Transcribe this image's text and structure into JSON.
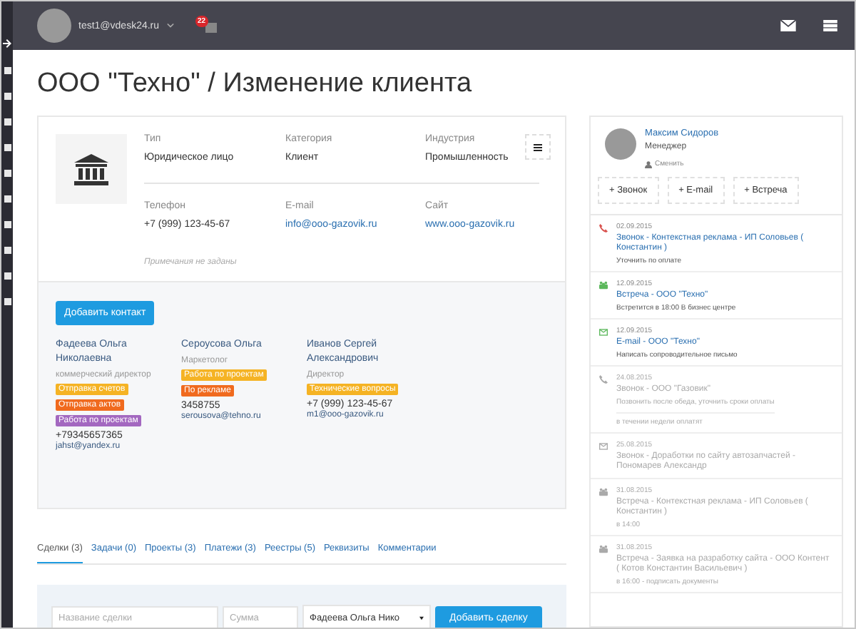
{
  "topbar": {
    "user_email": "test1@vdesk24.ru",
    "notification_count": "22"
  },
  "page_title": "ООО \"Техно\" / Изменение клиента",
  "client": {
    "fields": [
      {
        "label": "Тип",
        "value": "Юридическое лицо",
        "kind": "text"
      },
      {
        "label": "Категория",
        "value": "Клиент",
        "kind": "text"
      },
      {
        "label": "Индустрия",
        "value": "Промышленность",
        "kind": "text"
      },
      {
        "label": "Телефон",
        "value": "+7 (999) 123-45-67",
        "kind": "text"
      },
      {
        "label": "E-mail",
        "value": "info@ooo-gazovik.ru",
        "kind": "link"
      },
      {
        "label": "Сайт",
        "value": "www.ooo-gazovik.ru",
        "kind": "link"
      }
    ],
    "notes": "Примечания не заданы"
  },
  "add_contact_button": "Добавить контакт",
  "contacts": [
    {
      "name": "Фадеева Ольга Николаевна",
      "position": "коммерческий директор",
      "tags": [
        {
          "label": "Отправка счетов",
          "color": "#f5b324"
        },
        {
          "label": "Отправка актов",
          "color": "#f06a1e"
        },
        {
          "label": "Работа по проектам",
          "color": "#a368c0"
        }
      ],
      "phone": "+79345657365",
      "email": "jahst@yandex.ru"
    },
    {
      "name": "Сероусова Ольга",
      "position": "Маркетолог",
      "tags": [
        {
          "label": "Работа по проектам",
          "color": "#f5b324"
        },
        {
          "label": "По рекламе",
          "color": "#f06a1e"
        }
      ],
      "phone": "3458755",
      "email": "serousova@tehno.ru"
    },
    {
      "name": "Иванов Сергей Александрович",
      "position": "Директор",
      "tags": [
        {
          "label": "Технические вопросы",
          "color": "#f5b324"
        }
      ],
      "phone": "+7 (999) 123-45-67",
      "email": "m1@ooo-gazovik.ru"
    }
  ],
  "tabs": [
    {
      "label": "Сделки (3)",
      "selected": true
    },
    {
      "label": "Задачи (0)",
      "selected": false
    },
    {
      "label": "Проекты (3)",
      "selected": false
    },
    {
      "label": "Платежи (3)",
      "selected": false
    },
    {
      "label": "Реестры (5)",
      "selected": false
    },
    {
      "label": "Реквизиты",
      "selected": false
    },
    {
      "label": "Комментарии",
      "selected": false
    }
  ],
  "deal_form": {
    "name_placeholder": "Название сделки",
    "sum_placeholder": "Сумма",
    "contact_value": "Фадеева Ольга Нико",
    "submit": "Добавить сделку"
  },
  "manager": {
    "name": "Максим Сидоров",
    "role": "Менеджер",
    "change_link": "Сменить"
  },
  "actions": [
    "+ Звонок",
    "+ E-mail",
    "+ Встреча"
  ],
  "timeline": [
    {
      "kind": "call",
      "done": false,
      "date": "02.09.2015",
      "title": "Звонок - Контекстная реклама - ИП Соловьев ( Константин )",
      "note": "Уточнить по оплате"
    },
    {
      "kind": "meeting",
      "done": false,
      "date": "12.09.2015",
      "title": "Встреча - ООО \"Техно\"",
      "note": "Встретится в 18:00 В бизнес центре"
    },
    {
      "kind": "email",
      "done": false,
      "date": "12.09.2015",
      "title": "E-mail - ООО \"Техно\"",
      "note": "Написать сопроводительное письмо"
    },
    {
      "kind": "call",
      "done": true,
      "date": "24.08.2015",
      "title": "Звонок - ООО \"Газовик\"",
      "note": "Позвонить после обеда, уточнить сроки оплаты",
      "result": "в течении недели оплатят"
    },
    {
      "kind": "email",
      "done": true,
      "date": "25.08.2015",
      "title": "Звонок - Доработки по сайту автозапчастей - Пономарев Александр"
    },
    {
      "kind": "meeting",
      "done": true,
      "date": "31.08.2015",
      "title": "Встреча - Контекстная реклама - ИП Соловьев ( Константин )",
      "note": "в 14:00"
    },
    {
      "kind": "meeting",
      "done": true,
      "date": "31.08.2015",
      "title": "Встреча - Заявка на разработку сайта - ООО Контент ( Котов Константин Васильевич )",
      "note": "в 16:00 - подписать документы"
    }
  ]
}
